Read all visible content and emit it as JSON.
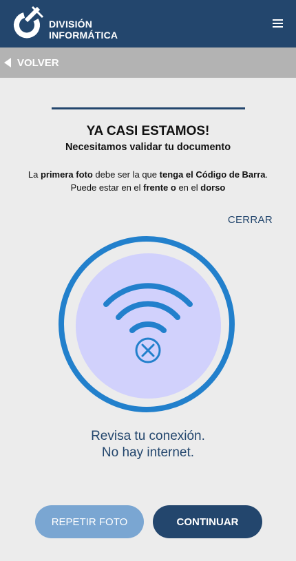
{
  "header": {
    "brand_line1": "DIVISIÓN",
    "brand_line2": "INFORMÁTICA",
    "logo_icon": "plug-logo-icon",
    "menu_icon": "hamburger-menu-icon"
  },
  "nav": {
    "back_label": "VOLVER",
    "back_icon": "triangle-left-icon"
  },
  "content": {
    "title": "YA CASI ESTAMOS!",
    "subtitle": "Necesitamos validar tu documento",
    "instruction": {
      "p1": "La ",
      "b1": "primera foto",
      "p2": " debe ser la que ",
      "b2": "tenga el Código de Barra",
      "p3": ".",
      "p4": "Puede estar en el ",
      "b3": "frente o",
      "p5": " en el ",
      "b4": "dorso"
    },
    "close_label": "CERRAR",
    "status_icon": "wifi-off-icon",
    "message_line1": "Revisa tu conexión.",
    "message_line2": "No hay internet."
  },
  "actions": {
    "repeat_label": "REPETIR FOTO",
    "continue_label": "CONTINUAR"
  },
  "colors": {
    "primary": "#23466d",
    "accent": "#2280cc",
    "disc": "#d1d1fc",
    "repeat_button": "#7aa6d2",
    "background": "#ececec",
    "nav_bar": "#b3b3b3"
  }
}
